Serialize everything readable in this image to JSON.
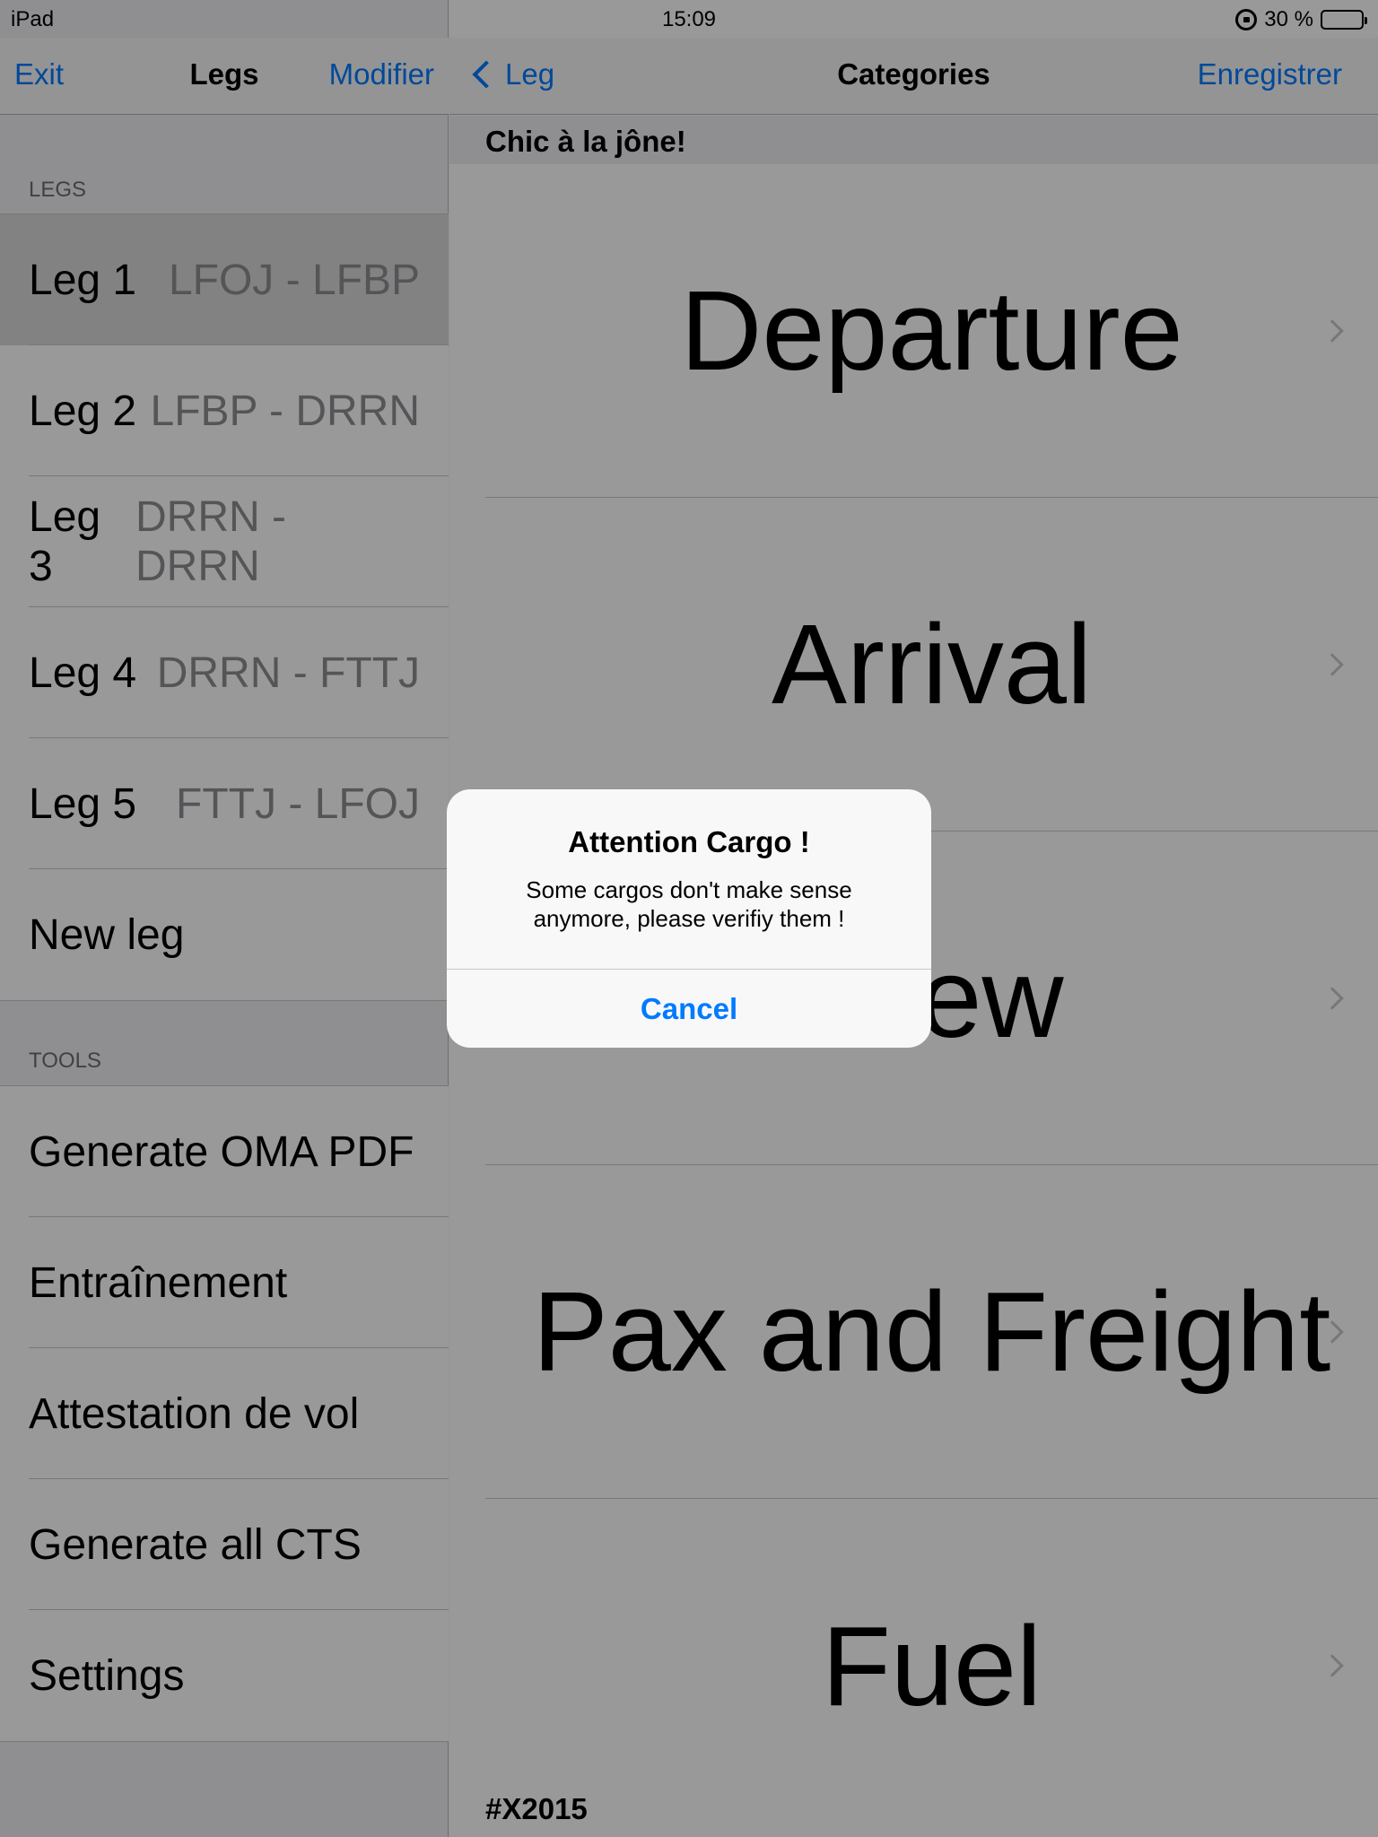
{
  "status_bar": {
    "device": "iPad",
    "time": "15:09",
    "battery": "30 %",
    "battery_level": 0.3
  },
  "master": {
    "navbar": {
      "left": "Exit",
      "title": "Legs",
      "right": "Modifier"
    },
    "legs_header": "LEGS",
    "legs": [
      {
        "label": "Leg 1",
        "route": "LFOJ - LFBP"
      },
      {
        "label": "Leg 2",
        "route": "LFBP - DRRN"
      },
      {
        "label": "Leg 3",
        "route": "DRRN - DRRN"
      },
      {
        "label": "Leg 4",
        "route": "DRRN - FTTJ"
      },
      {
        "label": "Leg 5",
        "route": "FTTJ - LFOJ"
      },
      {
        "label": "New leg"
      }
    ],
    "tools_header": "TOOLS",
    "tools": [
      "Generate OMA PDF",
      "Entraînement",
      "Attestation de vol",
      "Generate all CTS",
      "Settings"
    ]
  },
  "detail": {
    "navbar": {
      "back": "Leg",
      "title": "Categories",
      "right": "Enregistrer"
    },
    "header": "Chic à la jône!",
    "categories": [
      "Departure",
      "Arrival",
      "Crew",
      "Pax and Freight",
      "Fuel"
    ],
    "footer": "#X2015"
  },
  "alert": {
    "title": "Attention Cargo !",
    "message": "Some cargos don't make sense anymore, please verifiy them !",
    "button": "Cancel"
  },
  "colors": {
    "accent": "#007aff",
    "secondary_text": "#8e8e93",
    "overlay": "rgba(0,0,0,0.4)"
  }
}
